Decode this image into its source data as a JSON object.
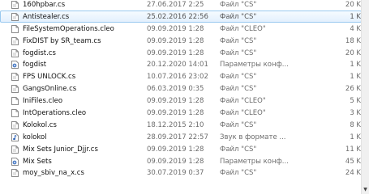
{
  "files": [
    {
      "name": "160hpbar.cs",
      "date": "27.06.2017 2:25",
      "type": "Файл \"CS\"",
      "size": "20 K",
      "icon": "cs-file-icon",
      "selected": false
    },
    {
      "name": "Antistealer.cs",
      "date": "25.02.2016 22:56",
      "type": "Файл \"CS\"",
      "size": "1 K",
      "icon": "cs-file-icon",
      "selected": true
    },
    {
      "name": "FileSystemOperations.cleo",
      "date": "09.09.2019 1:28",
      "type": "Файл \"CLEO\"",
      "size": "4 K",
      "icon": "file-icon",
      "selected": false
    },
    {
      "name": "FixDIST by SR_team.cs",
      "date": "09.09.2019 1:28",
      "type": "Файл \"CS\"",
      "size": "18 K",
      "icon": "cs-file-icon",
      "selected": false
    },
    {
      "name": "fogdist.cs",
      "date": "09.09.2019 1:28",
      "type": "Файл \"CS\"",
      "size": "20 K",
      "icon": "cs-file-icon",
      "selected": false
    },
    {
      "name": "fogdist",
      "date": "20.12.2020 14:01",
      "type": "Параметры конф...",
      "size": "1 K",
      "icon": "settings-file-icon",
      "selected": false
    },
    {
      "name": "FPS UNLOCK.cs",
      "date": "10.07.2016 23:02",
      "type": "Файл \"CS\"",
      "size": "1 K",
      "icon": "cs-file-icon",
      "selected": false
    },
    {
      "name": "GangsOnline.cs",
      "date": "06.03.2019 0:35",
      "type": "Файл \"CS\"",
      "size": "26 K",
      "icon": "cs-file-icon",
      "selected": false
    },
    {
      "name": "IniFiles.cleo",
      "date": "09.09.2019 1:28",
      "type": "Файл \"CLEO\"",
      "size": "5 K",
      "icon": "file-icon",
      "selected": false
    },
    {
      "name": "IntOperations.cleo",
      "date": "09.09.2019 1:28",
      "type": "Файл \"CLEO\"",
      "size": "3 K",
      "icon": "file-icon",
      "selected": false
    },
    {
      "name": "Kolokol.cs",
      "date": "18.12.2015 2:10",
      "type": "Файл \"CS\"",
      "size": "8 K",
      "icon": "cs-file-icon",
      "selected": false
    },
    {
      "name": "kolokol",
      "date": "28.09.2017 22:57",
      "type": "Звук в формате ...",
      "size": "1 K",
      "icon": "audio-file-icon",
      "selected": false
    },
    {
      "name": "Mix Sets Junior_Djjr.cs",
      "date": "09.09.2019 1:28",
      "type": "Файл \"CS\"",
      "size": "11 K",
      "icon": "cs-file-icon",
      "selected": false
    },
    {
      "name": "Mix Sets",
      "date": "09.09.2019 1:28",
      "type": "Параметры конф...",
      "size": "45 K",
      "icon": "settings-file-icon",
      "selected": false
    },
    {
      "name": "moy_sbiv_na_x.cs",
      "date": "30.07.2019 0:37",
      "type": "Файл \"CS\"",
      "size": "24 K",
      "icon": "cs-file-icon",
      "selected": false
    }
  ]
}
